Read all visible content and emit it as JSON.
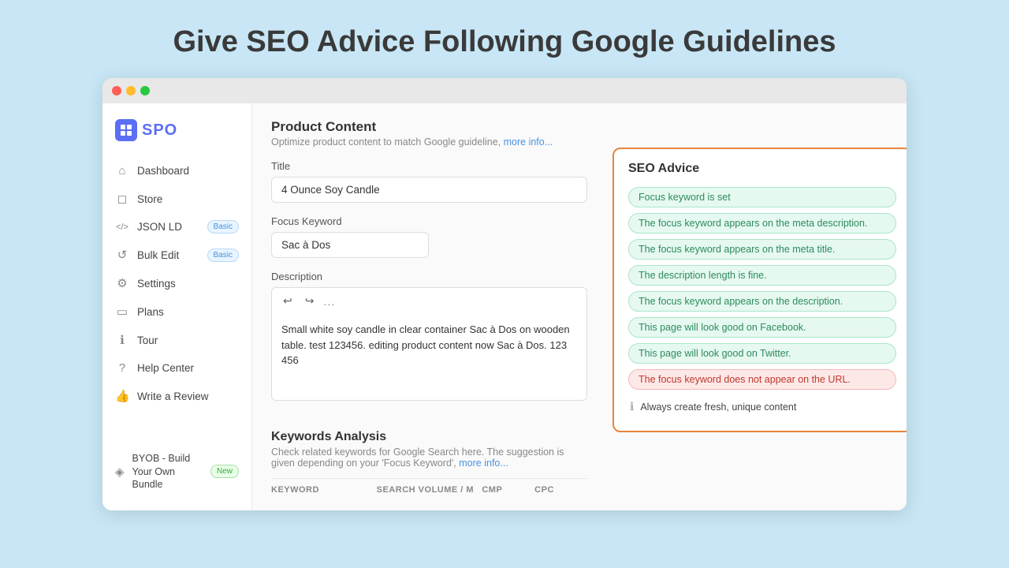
{
  "heading": "Give SEO Advice Following Google Guidelines",
  "browser": {
    "dots": [
      "red",
      "yellow",
      "green"
    ]
  },
  "sidebar": {
    "logo_text": "SPO",
    "items": [
      {
        "id": "dashboard",
        "label": "Dashboard",
        "icon": "⌂",
        "badge": null
      },
      {
        "id": "store",
        "label": "Store",
        "icon": "◻",
        "badge": null
      },
      {
        "id": "json-ld",
        "label": "JSON LD",
        "icon": "</>",
        "badge": "Basic"
      },
      {
        "id": "bulk-edit",
        "label": "Bulk Edit",
        "icon": "↺",
        "badge": "Basic"
      },
      {
        "id": "settings",
        "label": "Settings",
        "icon": "⚙",
        "badge": null
      },
      {
        "id": "plans",
        "label": "Plans",
        "icon": "▭",
        "badge": null
      },
      {
        "id": "tour",
        "label": "Tour",
        "icon": "ℹ",
        "badge": null
      },
      {
        "id": "help-center",
        "label": "Help Center",
        "icon": "?",
        "badge": null
      },
      {
        "id": "write-review",
        "label": "Write a Review",
        "icon": "👍",
        "badge": null
      },
      {
        "id": "byob",
        "label": "BYOB - Build Your Own Bundle",
        "icon": "◈",
        "badge": "New"
      }
    ]
  },
  "product_content": {
    "title": "Product Content",
    "subtitle": "Optimize product content to match Google guideline,",
    "subtitle_link": "more info...",
    "title_label": "Title",
    "title_value": "4 Ounce Soy Candle",
    "focus_keyword_label": "Focus Keyword",
    "focus_keyword_value": "Sac à Dos",
    "description_label": "Description",
    "description_text": "Small white soy candle in clear container Sac à Dos on wooden table. test 123456. editing product content now Sac à Dos. 123 456",
    "toolbar_undo": "↩",
    "toolbar_redo": "↪",
    "toolbar_dots": "..."
  },
  "seo_advice": {
    "title": "SEO Advice",
    "items": [
      {
        "text": "Focus keyword is set",
        "type": "green"
      },
      {
        "text": "The focus keyword appears on the meta description.",
        "type": "green"
      },
      {
        "text": "The focus keyword appears on the meta title.",
        "type": "green"
      },
      {
        "text": "The description length is fine.",
        "type": "green"
      },
      {
        "text": "The focus keyword appears on the description.",
        "type": "green"
      },
      {
        "text": "This page will look good on Facebook.",
        "type": "green"
      },
      {
        "text": "This page will look good on Twitter.",
        "type": "green"
      },
      {
        "text": "The focus keyword does not appear on the URL.",
        "type": "red"
      }
    ],
    "info_text": "Always create fresh, unique content"
  },
  "keywords_analysis": {
    "title": "Keywords Analysis",
    "description": "Check related keywords for Google Search here. The suggestion is given depending on your 'Focus Keyword',",
    "description_link": "more info...",
    "columns": [
      "KEYWORD",
      "SEARCH VOLUME / M",
      "CMP",
      "CPC"
    ]
  }
}
